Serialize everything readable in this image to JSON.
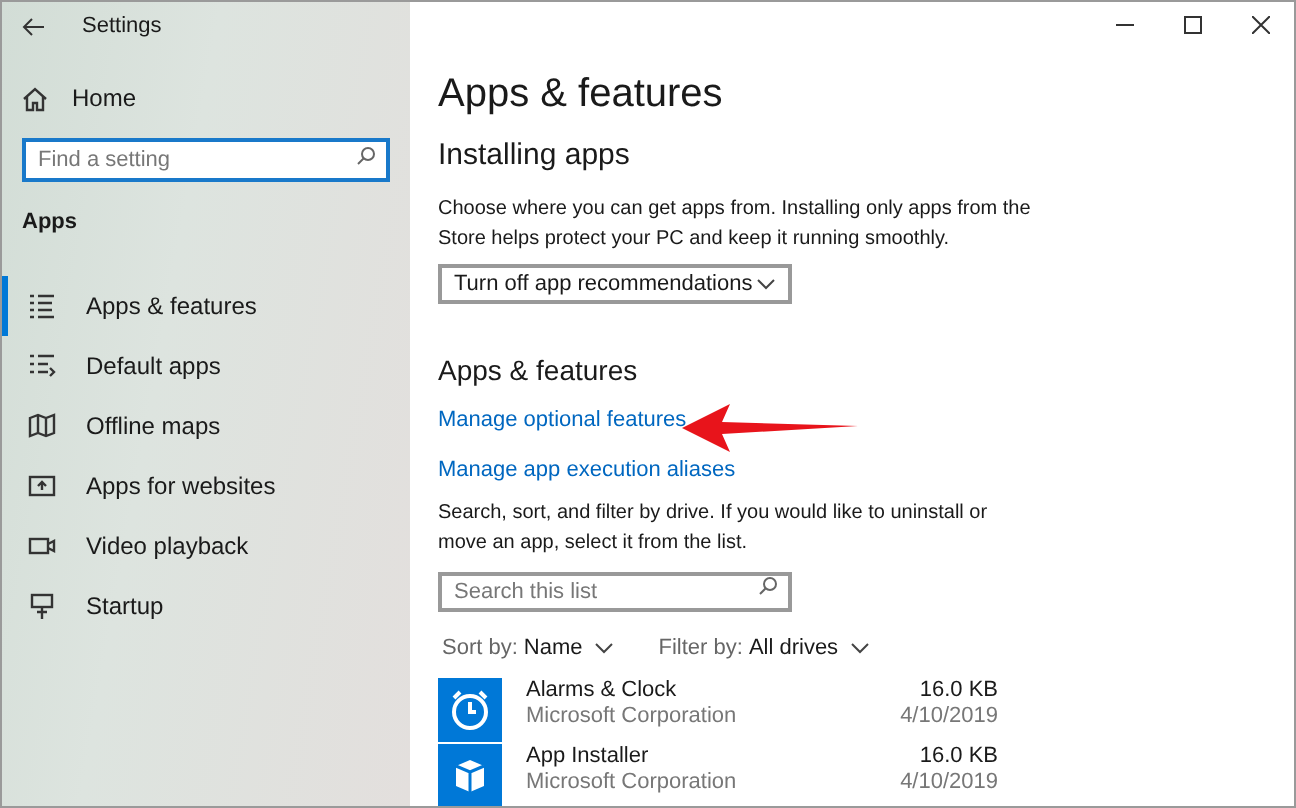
{
  "window": {
    "title": "Settings"
  },
  "sidebar": {
    "home": "Home",
    "search": {
      "placeholder": "Find a setting"
    },
    "section": "Apps",
    "items": [
      {
        "label": "Apps & features",
        "selected": true
      },
      {
        "label": "Default apps",
        "selected": false
      },
      {
        "label": "Offline maps",
        "selected": false
      },
      {
        "label": "Apps for websites",
        "selected": false
      },
      {
        "label": "Video playback",
        "selected": false
      },
      {
        "label": "Startup",
        "selected": false
      }
    ]
  },
  "main": {
    "title": "Apps & features",
    "installing": {
      "heading": "Installing apps",
      "description": "Choose where you can get apps from. Installing only apps from the Store helps protect your PC and keep it running smoothly.",
      "dropdown": "Turn off app recommendations"
    },
    "apps_section": {
      "heading": "Apps & features",
      "links": [
        "Manage optional features",
        "Manage app execution aliases"
      ],
      "description": "Search, sort, and filter by drive. If you would like to uninstall or move an app, select it from the list.",
      "search": {
        "placeholder": "Search this list"
      },
      "sort": {
        "label": "Sort by:",
        "value": "Name"
      },
      "filter": {
        "label": "Filter by:",
        "value": "All drives"
      },
      "apps": [
        {
          "name": "Alarms & Clock",
          "publisher": "Microsoft Corporation",
          "size": "16.0 KB",
          "date": "4/10/2019"
        },
        {
          "name": "App Installer",
          "publisher": "Microsoft Corporation",
          "size": "16.0 KB",
          "date": "4/10/2019"
        }
      ]
    }
  }
}
